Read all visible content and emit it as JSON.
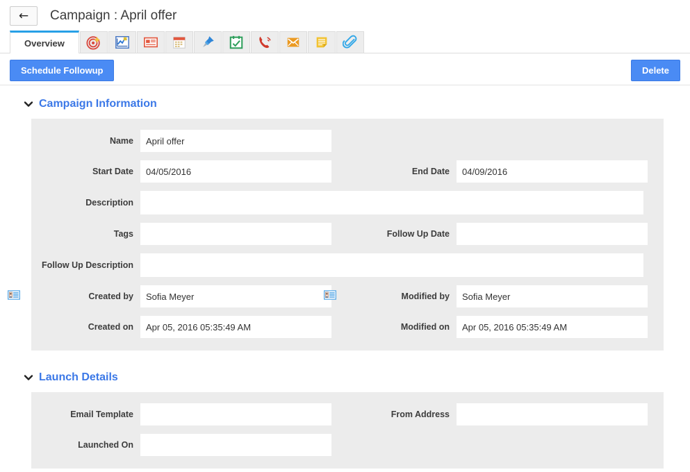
{
  "header": {
    "back_icon": "back-arrow-icon",
    "title": "Campaign : April offer"
  },
  "tabs": [
    {
      "label": "Overview",
      "icon": "overview-tab",
      "active": true
    },
    {
      "label": "",
      "icon": "target-icon",
      "active": false
    },
    {
      "label": "",
      "icon": "line-chart-icon",
      "active": false
    },
    {
      "label": "",
      "icon": "news-list-icon",
      "active": false
    },
    {
      "label": "",
      "icon": "calendar-icon",
      "active": false
    },
    {
      "label": "",
      "icon": "pin-icon",
      "active": false
    },
    {
      "label": "",
      "icon": "task-calendar-check-icon",
      "active": false
    },
    {
      "label": "",
      "icon": "phone-call-icon",
      "active": false
    },
    {
      "label": "",
      "icon": "envelope-icon",
      "active": false
    },
    {
      "label": "",
      "icon": "note-icon",
      "active": false
    },
    {
      "label": "",
      "icon": "paperclip-icon",
      "active": false
    }
  ],
  "actions": {
    "schedule_followup_label": "Schedule Followup",
    "delete_label": "Delete",
    "primary_color": "#4a8bf4"
  },
  "sections": [
    {
      "title": "Campaign Information",
      "expanded": true,
      "fields": {
        "name": {
          "label": "Name",
          "value": "April offer"
        },
        "start_date": {
          "label": "Start Date",
          "value": "04/05/2016"
        },
        "end_date": {
          "label": "End Date",
          "value": "04/09/2016"
        },
        "description": {
          "label": "Description",
          "value": ""
        },
        "tags": {
          "label": "Tags",
          "value": ""
        },
        "follow_up_date": {
          "label": "Follow Up Date",
          "value": ""
        },
        "follow_up_description": {
          "label": "Follow Up Description",
          "value": ""
        },
        "created_by": {
          "label": "Created by",
          "value": "Sofia Meyer",
          "icon": "contact-card-icon"
        },
        "modified_by": {
          "label": "Modified by",
          "value": "Sofia Meyer",
          "icon": "contact-card-icon"
        },
        "created_on": {
          "label": "Created on",
          "value": "Apr 05, 2016 05:35:49 AM"
        },
        "modified_on": {
          "label": "Modified on",
          "value": "Apr 05, 2016 05:35:49 AM"
        }
      }
    },
    {
      "title": "Launch Details",
      "expanded": true,
      "fields": {
        "email_template": {
          "label": "Email Template",
          "value": ""
        },
        "from_address": {
          "label": "From Address",
          "value": ""
        },
        "launched_on": {
          "label": "Launched On",
          "value": ""
        }
      }
    }
  ],
  "colors": {
    "section_title": "#3b78e7",
    "panel_bg": "#ececec",
    "tab_active_border": "#27a0e6"
  }
}
